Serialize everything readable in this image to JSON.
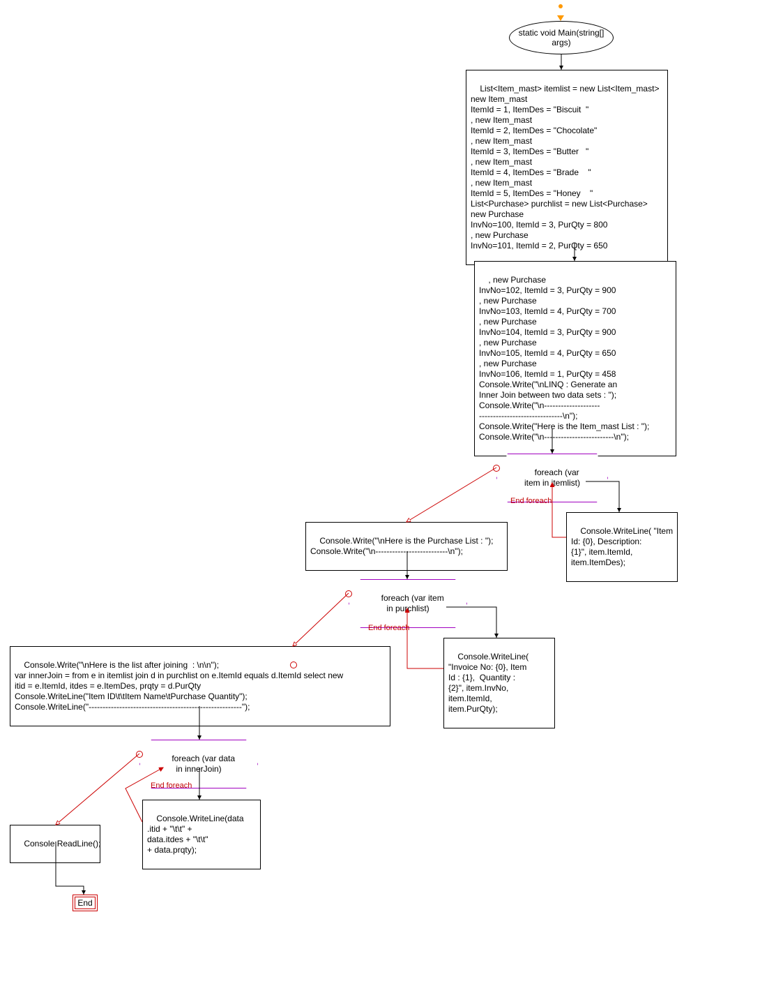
{
  "chart_data": {
    "type": "flowchart",
    "title": "",
    "nodes": [
      {
        "id": "start",
        "kind": "terminator",
        "text": "static void\nMain(string[] args)"
      },
      {
        "id": "n1",
        "kind": "process",
        "text": "List<Item_mast> itemlist = new List<Item_mast>\nnew Item_mast\nItemId = 1, ItemDes = \"Biscuit  \"\n, new Item_mast\nItemId = 2, ItemDes = \"Chocolate\"\n, new Item_mast\nItemId = 3, ItemDes = \"Butter   \"\n, new Item_mast\nItemId = 4, ItemDes = \"Brade    \"\n, new Item_mast\nItemId = 5, ItemDes = \"Honey    \"\nList<Purchase> purchlist = new List<Purchase>\nnew Purchase\nInvNo=100, ItemId = 3, PurQty = 800\n, new Purchase\nInvNo=101, ItemId = 2, PurQty = 650"
      },
      {
        "id": "n2",
        "kind": "process",
        "text": ", new Purchase\nInvNo=102, ItemId = 3, PurQty = 900\n, new Purchase\nInvNo=103, ItemId = 4, PurQty = 700\n, new Purchase\nInvNo=104, ItemId = 3, PurQty = 900\n, new Purchase\nInvNo=105, ItemId = 4, PurQty = 650\n, new Purchase\nInvNo=106, ItemId = 1, PurQty = 458\nConsole.Write(\"\\nLINQ : Generate an\nInner Join between two data sets : \");\nConsole.Write(\"\\n--------------------\n------------------------------\\n\");\nConsole.Write(\"Here is the Item_mast List : \");\nConsole.Write(\"\\n-------------------------\\n\");"
      },
      {
        "id": "loop1",
        "kind": "decision",
        "text": "foreach (var\nitem in itemlist)"
      },
      {
        "id": "body1",
        "kind": "process",
        "text": "Console.WriteLine( \"Item\nId: {0}, Description:\n{1}\", item.ItemId,\nitem.ItemDes);"
      },
      {
        "id": "n3",
        "kind": "process",
        "text": "Console.Write(\"\\nHere is the Purchase List : \");\nConsole.Write(\"\\n--------------------------\\n\");"
      },
      {
        "id": "loop2",
        "kind": "decision",
        "text": "foreach (var item\nin purchlist)"
      },
      {
        "id": "body2",
        "kind": "process",
        "text": "Console.WriteLine(\n\"Invoice No: {0}, Item\nId : {1},  Quantity :\n{2}\", item.InvNo,\nitem.ItemId,\nitem.PurQty);"
      },
      {
        "id": "n4",
        "kind": "process",
        "text": "Console.Write(\"\\nHere is the list after joining  : \\n\\n\");\nvar innerJoin = from e in itemlist join d in purchlist on e.ItemId equals d.ItemId select new\nitid = e.ItemId, itdes = e.ItemDes, prqty = d.PurQty\nConsole.WriteLine(\"Item ID\\t\\tItem Name\\tPurchase Quantity\");\nConsole.WriteLine(\"-------------------------------------------------------\");"
      },
      {
        "id": "loop3",
        "kind": "decision",
        "text": "foreach (var data\nin innerJoin)"
      },
      {
        "id": "body3",
        "kind": "process",
        "text": "Console.WriteLine(data\n.itid + \"\\t\\t\" +\ndata.itdes + \"\\t\\t\"\n+ data.prqty);"
      },
      {
        "id": "n5",
        "kind": "process",
        "text": "Console.ReadLine();"
      },
      {
        "id": "end",
        "kind": "end",
        "text": "End"
      }
    ],
    "edges": [
      {
        "from": "start",
        "to": "n1"
      },
      {
        "from": "n1",
        "to": "n2"
      },
      {
        "from": "n2",
        "to": "loop1"
      },
      {
        "from": "loop1",
        "to": "body1"
      },
      {
        "from": "body1",
        "to": "loop1",
        "label": "End foreach"
      },
      {
        "from": "loop1",
        "to": "n3",
        "exit": true
      },
      {
        "from": "n3",
        "to": "loop2"
      },
      {
        "from": "loop2",
        "to": "body2"
      },
      {
        "from": "body2",
        "to": "loop2",
        "label": "End foreach"
      },
      {
        "from": "loop2",
        "to": "n4",
        "exit": true
      },
      {
        "from": "n4",
        "to": "loop3"
      },
      {
        "from": "loop3",
        "to": "body3"
      },
      {
        "from": "body3",
        "to": "loop3",
        "label": "End foreach"
      },
      {
        "from": "loop3",
        "to": "n5",
        "exit": true
      },
      {
        "from": "n5",
        "to": "end"
      }
    ],
    "edge_labels": {
      "end_foreach": "End foreach"
    }
  }
}
